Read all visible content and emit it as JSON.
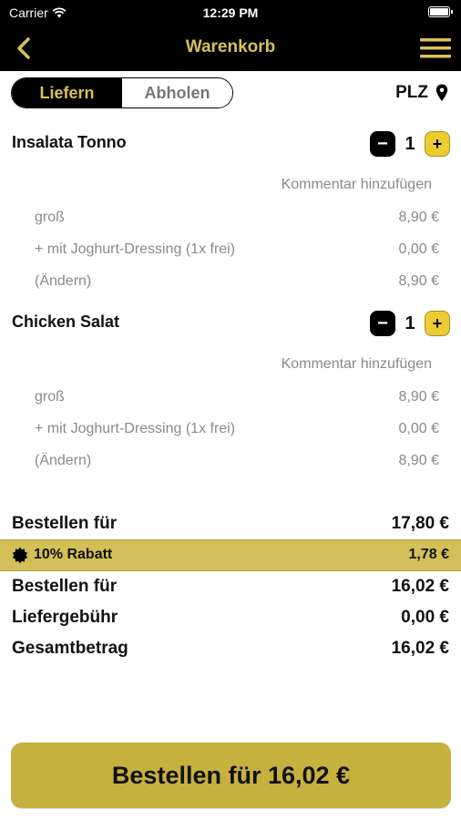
{
  "status_bar": {
    "carrier": "Carrier",
    "time": "12:29 PM"
  },
  "nav": {
    "title": "Warenkorb"
  },
  "delivery_toggle": {
    "options": [
      "Liefern",
      "Abholen"
    ],
    "selected": "Liefern"
  },
  "plz_label": "PLZ",
  "items": [
    {
      "name": "Insalata Tonno",
      "quantity": "1",
      "comment_link": "Kommentar hinzufügen",
      "details": [
        {
          "label": "groß",
          "price": "8,90 €"
        },
        {
          "label": "+ mit Joghurt-Dressing (1x frei)",
          "price": "0,00 €"
        },
        {
          "label": "(Ändern)",
          "price": "8,90 €"
        }
      ]
    },
    {
      "name": "Chicken Salat",
      "quantity": "1",
      "comment_link": "Kommentar hinzufügen",
      "details": [
        {
          "label": "groß",
          "price": "8,90 €"
        },
        {
          "label": "+ mit Joghurt-Dressing (1x frei)",
          "price": "0,00 €"
        },
        {
          "label": "(Ändern)",
          "price": "8,90 €"
        }
      ]
    }
  ],
  "summary": {
    "subtotal": {
      "label": "Bestellen für",
      "value": "17,80 €"
    },
    "discount": {
      "label": "10% Rabatt",
      "value": "1,78 €"
    },
    "after_discount": {
      "label": "Bestellen für",
      "value": "16,02 €"
    },
    "delivery_fee": {
      "label": "Liefergebühr",
      "value": "0,00 €"
    },
    "total": {
      "label": "Gesamtbetrag",
      "value": "16,02 €"
    }
  },
  "order_button": {
    "label": "Bestellen für 16,02 €"
  },
  "colors": {
    "accent": "#d8c159",
    "button": "#c7b13e",
    "discount_bar": "#d3bf57",
    "plus_button": "#ebcd33"
  },
  "icons": {
    "back": "chevron-left-icon",
    "menu": "hamburger-menu-icon",
    "location": "location-pin-icon",
    "wifi": "wifi-icon",
    "battery": "battery-icon",
    "badge": "badge-icon",
    "minus": "minus-icon",
    "plus": "plus-icon"
  }
}
